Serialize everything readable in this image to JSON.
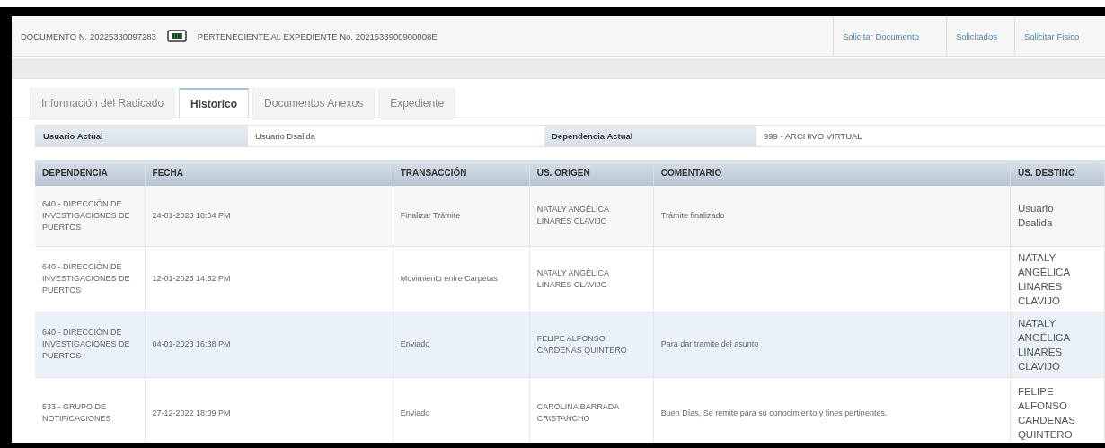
{
  "header": {
    "document": "DOCUMENTO N. 20225330097283",
    "expediente": "PERTENECIENTE AL EXPEDIENTE No. 2021533900900008E",
    "links": [
      "Solicitar Documento",
      "Solicitados",
      "Solicitar Fisico"
    ]
  },
  "tabs": [
    {
      "label": "Información del Radicado",
      "selected": false
    },
    {
      "label": "Historico",
      "selected": true
    },
    {
      "label": "Documentos Anexos",
      "selected": false
    },
    {
      "label": "Expediente",
      "selected": false
    }
  ],
  "info": [
    {
      "label": "Usuario Actual",
      "value": "Usuario Dsalida"
    },
    {
      "label": "Dependencia Actual",
      "value": "999 - ARCHIVO VIRTUAL"
    }
  ],
  "table": {
    "columns": [
      "DEPENDENCIA",
      "FECHA",
      "TRANSACCIÓN",
      "US. ORIGEN",
      "COMENTARIO",
      "US. DESTINO"
    ],
    "rows": [
      {
        "selected": false,
        "cells": [
          "640 - DIRECCIÓN DE INVESTIGACIONES DE PUERTOS",
          "24-01-2023 18:04 PM",
          "Finalizar Trámite",
          "NATALY ANGÉLICA LINARES CLAVIJO",
          "Trámite finalizado",
          "Usuario Dsalida"
        ]
      },
      {
        "selected": false,
        "cells": [
          "640 - DIRECCIÓN DE INVESTIGACIONES DE PUERTOS",
          "12-01-2023 14:52 PM",
          "Movimiento entre Carpetas",
          "NATALY ANGÉLICA LINARES CLAVIJO",
          "",
          "NATALY ANGÉLICA LINARES CLAVIJO"
        ]
      },
      {
        "selected": true,
        "cells": [
          "640 - DIRECCIÓN DE INVESTIGACIONES DE PUERTOS",
          "04-01-2023 16:38 PM",
          "Enviado",
          "FELIPE ALFONSO CARDENAS QUINTERO",
          "Para dar tramite del asunto",
          "NATALY ANGÉLICA LINARES CLAVIJO"
        ]
      },
      {
        "selected": false,
        "cells": [
          "533 - GRUPO DE NOTIFICACIONES",
          "27-12-2022 18:09 PM",
          "Enviado",
          "CAROLINA BARRADA CRISTANCHO",
          "Buen Días, Se remite para su conocimiento y fines pertinentes.",
          "FELIPE ALFONSO CARDENAS QUINTERO"
        ]
      }
    ]
  }
}
